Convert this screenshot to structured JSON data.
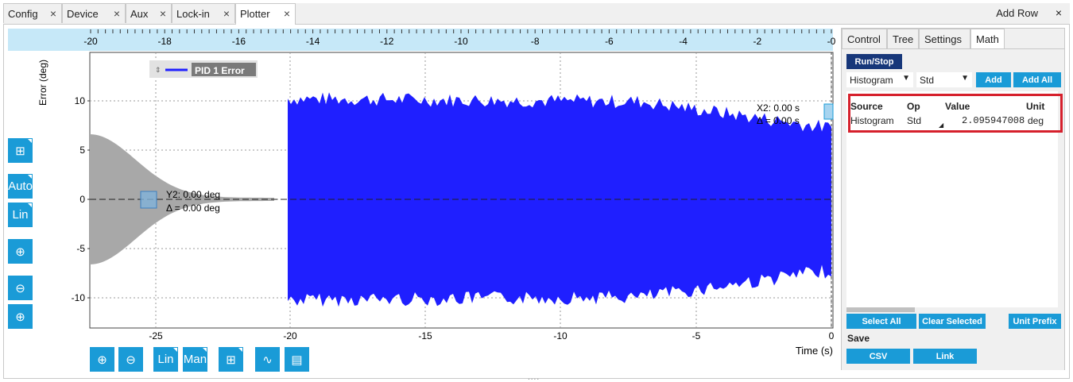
{
  "tabs": [
    {
      "label": "Config"
    },
    {
      "label": "Device"
    },
    {
      "label": "Aux"
    },
    {
      "label": "Lock-in"
    },
    {
      "label": "Plotter"
    }
  ],
  "add_row": "Add Row",
  "close_glyph": "×",
  "plot": {
    "y_axis_label": "Error (deg)",
    "x_axis_label": "Time (s)",
    "top_axis_ticks": [
      "-20",
      "-18",
      "-16",
      "-14",
      "-12",
      "-10",
      "-8",
      "-6",
      "-4",
      "-2",
      "-0"
    ],
    "bottom_axis_ticks": [
      "-25",
      "-20",
      "-15",
      "-10",
      "-5",
      "0"
    ],
    "y_ticks": [
      "10",
      "5",
      "0",
      "-5",
      "-10"
    ],
    "legend": "PID 1 Error",
    "cursor_x": {
      "line1": "X2: 0.00 s",
      "line2": "Δ = 0.00 s"
    },
    "cursor_y": {
      "line1": "Y2: 0.00 deg",
      "line2": "Δ = 0.00 deg"
    },
    "series_color": "#1f1fff",
    "histogram_color": "#a8a8a8"
  },
  "left_tools": [
    {
      "name": "grid-cursor-tool-icon"
    },
    {
      "label": "Auto"
    },
    {
      "label": "Lin"
    },
    {
      "name": "zoom-fit-icon"
    },
    {
      "name": "zoom-out-icon"
    },
    {
      "name": "zoom-in-icon"
    }
  ],
  "bottom_tools": [
    {
      "name": "zoom-in-icon"
    },
    {
      "name": "zoom-out-icon"
    },
    {
      "label": "Lin"
    },
    {
      "label": "Man"
    },
    {
      "name": "grid-cursor-tool-icon"
    },
    {
      "name": "export-waveform-icon"
    },
    {
      "name": "export-table-icon"
    }
  ],
  "panel": {
    "tabs": [
      "Control",
      "Tree",
      "Settings",
      "Math"
    ],
    "run_stop": "Run/Stop",
    "source_select": "Histogram",
    "op_select": "Std",
    "add": "Add",
    "add_all": "Add All",
    "table": {
      "headers": {
        "source": "Source",
        "op": "Op",
        "value": "Value",
        "unit": "Unit"
      },
      "row": {
        "source": "Histogram",
        "op": "Std",
        "value": "2.095947008",
        "unit": "deg"
      }
    },
    "select_all": "Select All",
    "clear_selected": "Clear Selected",
    "unit_prefix": "Unit Prefix",
    "save": "Save",
    "csv": "CSV",
    "link": "Link"
  },
  "colors": {
    "accent": "#1a9bd7",
    "dark_button": "#17377a",
    "highlight": "#d6202c"
  }
}
